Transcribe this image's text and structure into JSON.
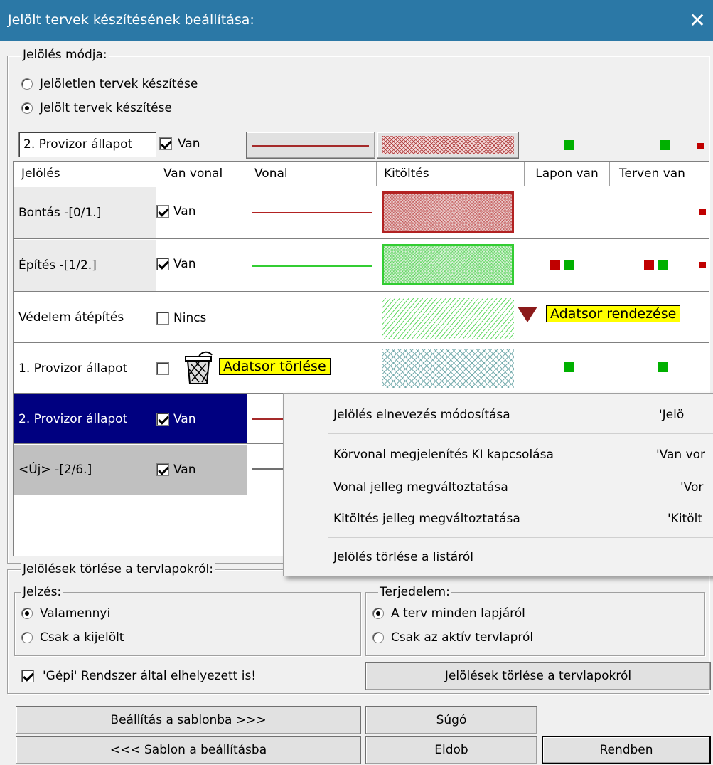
{
  "window": {
    "title": "Jelölt tervek készítésének beállítása:",
    "close": "✕"
  },
  "mode": {
    "legend": "Jelölés módja:",
    "options": [
      {
        "label": "Jelöletlen tervek készítése",
        "selected": false
      },
      {
        "label": "Jelölt tervek készítése",
        "selected": true
      }
    ]
  },
  "editor": {
    "name_value": "2. Provizor állapot",
    "van_label": "Van",
    "van_checked": true,
    "line_color": "#a52a2a",
    "fill_color": "#a52a2a"
  },
  "table": {
    "columns": [
      "Jelölés",
      "Van vonal",
      "Vonal",
      "Kitöltés",
      "Lapon van",
      "Terven van"
    ],
    "rows": [
      {
        "name": "Bontás -[0/1.]",
        "vanvonal": "Van",
        "checked": true,
        "line_color": "#b22222",
        "fill_color": "#b22222",
        "fill_style": "dense"
      },
      {
        "name": "Építés -[1/2.]",
        "vanvonal": "Van",
        "checked": true,
        "line_color": "#32cd32",
        "fill_color": "#32cd32",
        "fill_style": "dense"
      },
      {
        "name": "Védelem átépítés",
        "vanvonal": "Nincs",
        "checked": false,
        "line_color": "",
        "fill_color": "#32cd32",
        "fill_style": "diag"
      },
      {
        "name": "1. Provizor állapot",
        "vanvonal": "",
        "checked": false,
        "line_color": "",
        "fill_color": "#5f9ea0",
        "fill_style": "cross"
      },
      {
        "name": "2. Provizor állapot",
        "vanvonal": "Van",
        "checked": true,
        "line_color": "#a52a2a",
        "fill_color": "",
        "fill_style": ""
      },
      {
        "name": "<Új> -[2/6.]",
        "vanvonal": "Van",
        "checked": true,
        "line_color": "#707070",
        "fill_color": "",
        "fill_style": ""
      }
    ],
    "tooltip_sort": "Adatsor rendezése",
    "tooltip_delete": "Adatsor törlése"
  },
  "context_menu": {
    "items": [
      {
        "label": "Jelölés elnevezés módosítása",
        "shortcut": "'Jelö"
      },
      {
        "label": "Körvonal megjelenítés KI kapcsolása",
        "shortcut": "'Van vor"
      },
      {
        "label": "Vonal jelleg megváltoztatása",
        "shortcut": "'Vor"
      },
      {
        "label": "Kitöltés jelleg megváltoztatása",
        "shortcut": "'Kitölt"
      },
      {
        "label": "Jelölés törlése a listáról",
        "shortcut": ""
      }
    ]
  },
  "delete_group": {
    "legend": "Jelölések törlése a tervlapokról:",
    "jelzes": {
      "legend": "Jelzés:",
      "options": [
        {
          "label": "Valamennyi",
          "selected": true
        },
        {
          "label": "Csak a kijelölt",
          "selected": false
        }
      ]
    },
    "terjedelem": {
      "legend": "Terjedelem:",
      "options": [
        {
          "label": "A terv minden lapjáról",
          "selected": true
        },
        {
          "label": "Csak az aktív tervlapról",
          "selected": false
        }
      ]
    },
    "gepi_label": "'Gépi' Rendszer által elhelyezett is!",
    "gepi_checked": true,
    "delete_button": "Jelölések törlése a tervlapokról"
  },
  "buttons": {
    "to_template": "Beállítás a sablonba >>>",
    "help": "Súgó",
    "from_template": "<<< Sablon a beállításba",
    "cancel": "Eldob",
    "ok": "Rendben"
  },
  "colors": {
    "titlebar": "#2b78a6",
    "selected_row": "#000080",
    "green_marker": "#00b000",
    "red_marker": "#c00000",
    "tooltip": "#ffff00"
  }
}
